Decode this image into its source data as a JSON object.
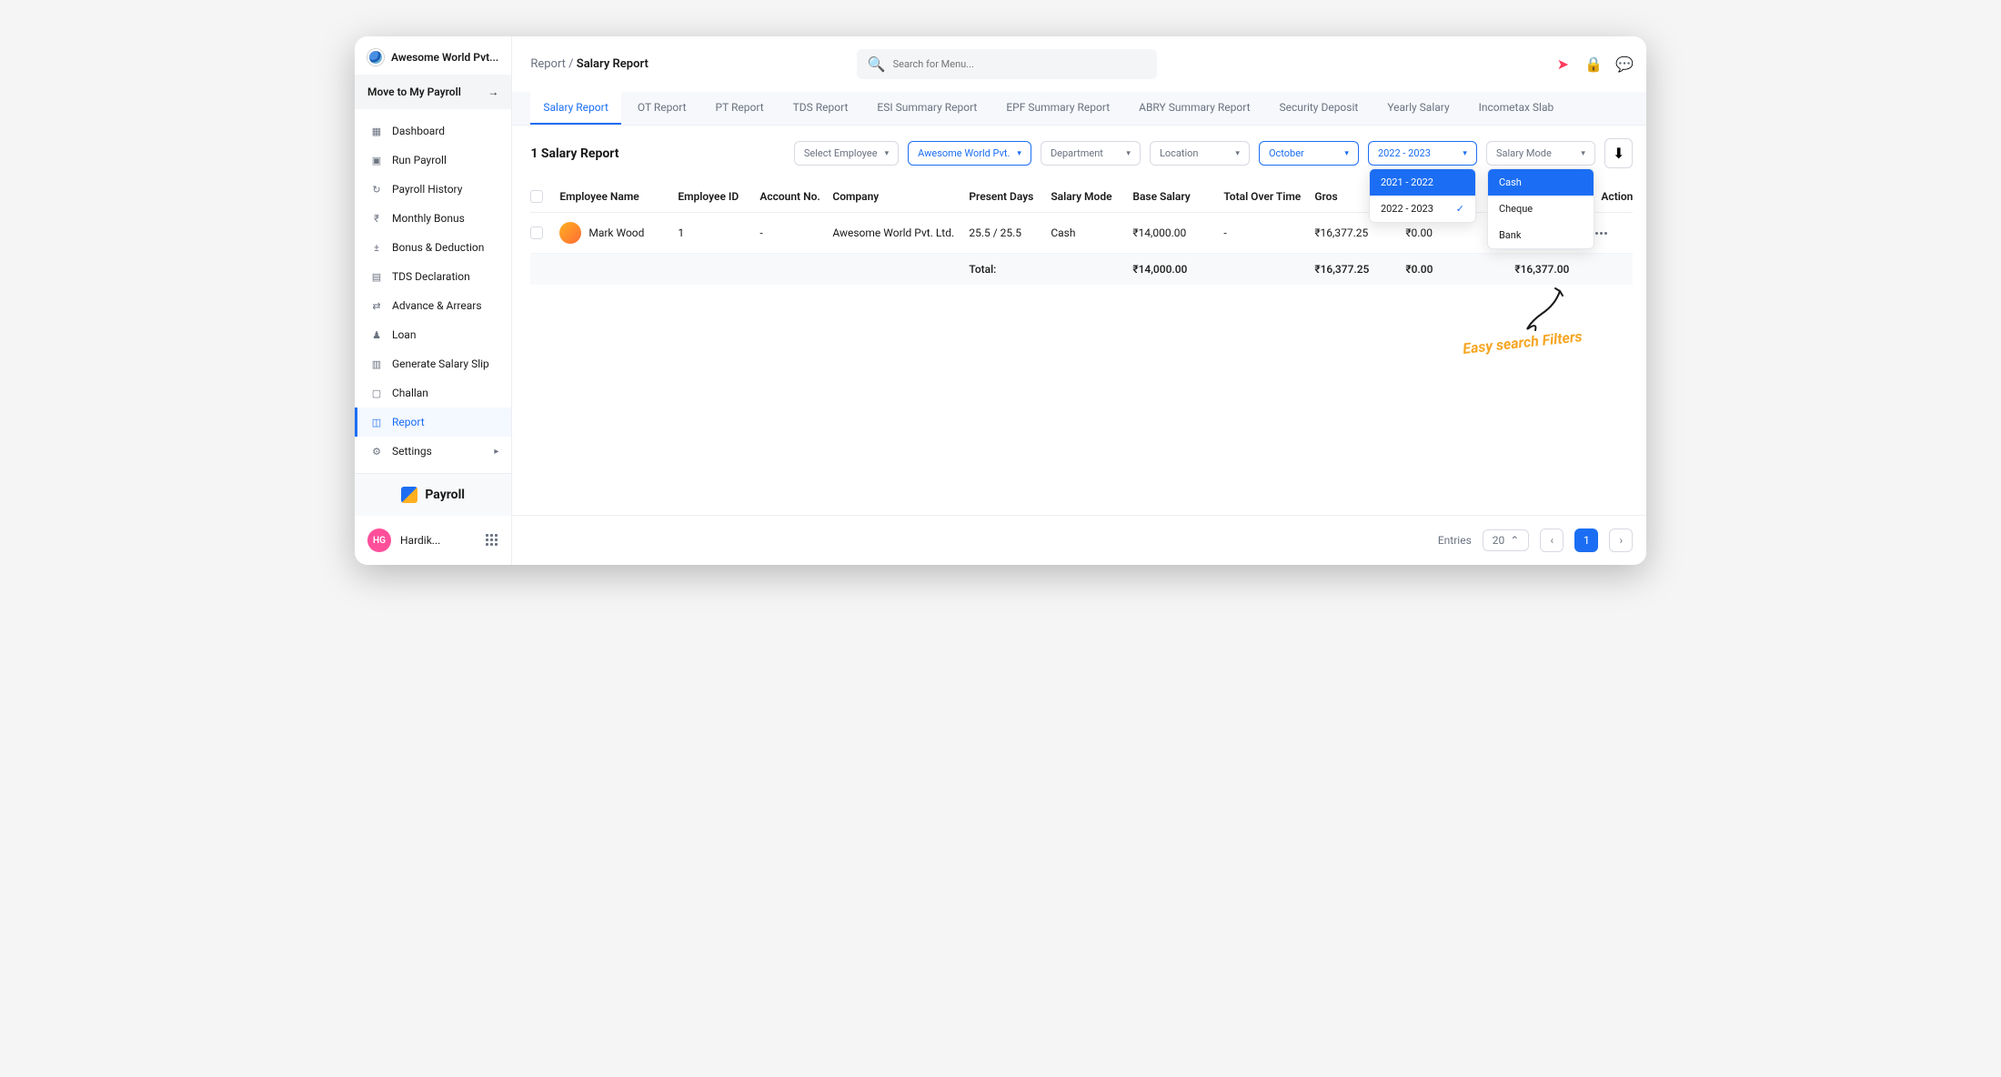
{
  "brand": {
    "name": "Awesome World Pvt..."
  },
  "move": {
    "label": "Move to My Payroll"
  },
  "nav": [
    {
      "icon": "▦",
      "label": "Dashboard"
    },
    {
      "icon": "▣",
      "label": "Run Payroll"
    },
    {
      "icon": "↻",
      "label": "Payroll History"
    },
    {
      "icon": "₹",
      "label": "Monthly Bonus"
    },
    {
      "icon": "±",
      "label": "Bonus & Deduction"
    },
    {
      "icon": "▤",
      "label": "TDS Declaration"
    },
    {
      "icon": "⇄",
      "label": "Advance & Arrears"
    },
    {
      "icon": "♟",
      "label": "Loan"
    },
    {
      "icon": "▥",
      "label": "Generate Salary Slip"
    },
    {
      "icon": "▢",
      "label": "Challan"
    },
    {
      "icon": "◫",
      "label": "Report",
      "active": true
    },
    {
      "icon": "⚙",
      "label": "Settings",
      "expand": true
    }
  ],
  "bottomBrand": "Payroll",
  "user": {
    "initials": "HG",
    "name": "Hardik..."
  },
  "crumb": {
    "root": "Report",
    "current": "Salary Report"
  },
  "search": {
    "placeholder": "Search for Menu..."
  },
  "tabs": [
    "Salary Report",
    "OT Report",
    "PT Report",
    "TDS Report",
    "ESI Summary Report",
    "EPF Summary Report",
    "ABRY Summary Report",
    "Security Deposit",
    "Yearly Salary",
    "Incometax Slab"
  ],
  "activeTab": 0,
  "heading": "1 Salary Report",
  "filters": {
    "employee": "Select Employee",
    "company": "Awesome World Pvt.",
    "department": "Department",
    "location": "Location",
    "month": "October",
    "year": "2022 - 2023",
    "mode": "Salary Mode",
    "yearOptions": [
      "2021 - 2022",
      "2022 - 2023"
    ],
    "modeOptions": [
      "Cash",
      "Cheque",
      "Bank"
    ]
  },
  "columns": [
    "Employee Name",
    "Employee ID",
    "Account No.",
    "Company",
    "Present Days",
    "Salary Mode",
    "Base Salary",
    "Total Over Time",
    "Gros",
    "",
    "Action"
  ],
  "rows": [
    {
      "name": "Mark Wood",
      "id": "1",
      "acct": "-",
      "company": "Awesome World Pvt. Ltd.",
      "present": "25.5 / 25.5",
      "mode": "Cash",
      "base": "₹14,000.00",
      "ot": "-",
      "gross": "₹16,377.25",
      "c2": "₹0.00"
    }
  ],
  "totals": {
    "label": "Total:",
    "base": "₹14,000.00",
    "gross": "₹16,377.25",
    "c2": "₹0.00",
    "net": "₹16,377.00"
  },
  "callout": "Easy search Filters",
  "pager": {
    "entries": "Entries",
    "size": "20",
    "page": "1"
  }
}
